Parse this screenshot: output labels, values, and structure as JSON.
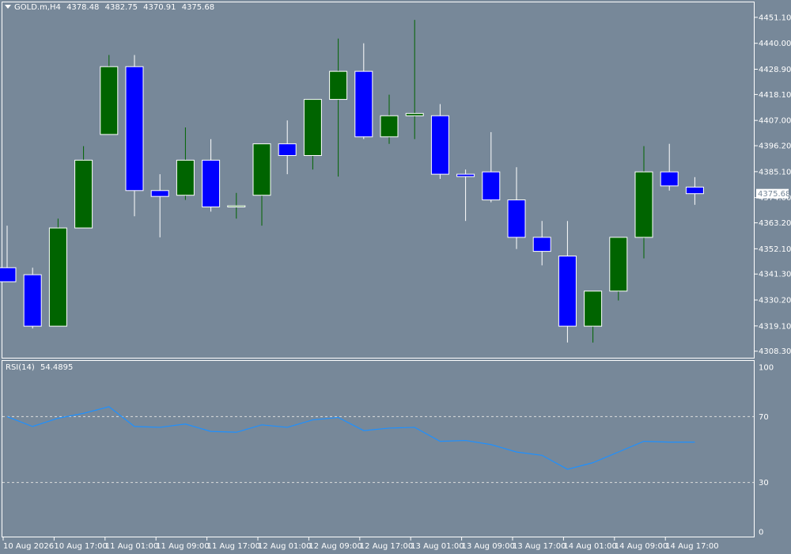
{
  "header": {
    "symbol": "GOLD.m,H4",
    "open": "4378.48",
    "high": "4382.75",
    "low": "4370.91",
    "close": "4375.68"
  },
  "rsi_header": {
    "name": "RSI(14)",
    "value": "54.4895"
  },
  "colors": {
    "background": "#778899",
    "bull_fill": "#006400",
    "bear_fill": "#0000ff",
    "bull_wick": "#006400",
    "bear_wick": "#ffffff",
    "grid_frame": "#ffffff",
    "rsi_line": "#1e90ff",
    "price_tag_bg": "#ffffff",
    "price_tag_text": "#778899"
  },
  "chart_data": [
    {
      "type": "candlestick",
      "title": "GOLD.m,H4",
      "ylim": [
        4305.5,
        4457.5
      ],
      "y_ticks": [
        4451.1,
        4440.0,
        4428.9,
        4418.1,
        4407.0,
        4396.2,
        4385.1,
        4374.0,
        4363.2,
        4352.1,
        4341.3,
        4330.2,
        4319.1,
        4308.3
      ],
      "y_tick_labels": [
        "4451.10",
        "4440.00",
        "4428.90",
        "4418.10",
        "4407.00",
        "4396.20",
        "4385.10",
        "4374.00",
        "4363.20",
        "4352.10",
        "4341.30",
        "4330.20",
        "4319.10",
        "4308.30"
      ],
      "current_price_label": "4375.68",
      "current_price": 4375.68,
      "x_labels": [
        "10 Aug 2026",
        "10 Aug 17:00",
        "11 Aug 01:00",
        "11 Aug 09:00",
        "11 Aug 17:00",
        "12 Aug 01:00",
        "12 Aug 09:00",
        "12 Aug 17:00",
        "13 Aug 01:00",
        "13 Aug 09:00",
        "13 Aug 17:00",
        "14 Aug 01:00",
        "14 Aug 09:00",
        "14 Aug 17:00"
      ],
      "candles": [
        {
          "o": 4344.0,
          "h": 4362.0,
          "l": 4344.0,
          "c": 4338.0
        },
        {
          "o": 4341.0,
          "h": 4344.0,
          "l": 4318.0,
          "c": 4319.0
        },
        {
          "o": 4319.0,
          "h": 4365.0,
          "l": 4319.0,
          "c": 4361.0
        },
        {
          "o": 4361.0,
          "h": 4396.0,
          "l": 4361.0,
          "c": 4390.0
        },
        {
          "o": 4401.0,
          "h": 4435.0,
          "l": 4401.0,
          "c": 4430.0
        },
        {
          "o": 4430.0,
          "h": 4435.0,
          "l": 4366.0,
          "c": 4377.0
        },
        {
          "o": 4377.0,
          "h": 4384.0,
          "l": 4357.0,
          "c": 4374.5
        },
        {
          "o": 4375.0,
          "h": 4404.0,
          "l": 4373.0,
          "c": 4390.0
        },
        {
          "o": 4390.0,
          "h": 4399.0,
          "l": 4368.0,
          "c": 4370.0
        },
        {
          "o": 4370.0,
          "h": 4376.0,
          "l": 4365.0,
          "c": 4370.5
        },
        {
          "o": 4375.0,
          "h": 4397.0,
          "l": 4362.0,
          "c": 4397.0
        },
        {
          "o": 4397.0,
          "h": 4407.0,
          "l": 4384.0,
          "c": 4392.0
        },
        {
          "o": 4392.0,
          "h": 4416.0,
          "l": 4386.0,
          "c": 4416.0
        },
        {
          "o": 4416.0,
          "h": 4442.0,
          "l": 4383.0,
          "c": 4428.0
        },
        {
          "o": 4428.0,
          "h": 4440.0,
          "l": 4399.0,
          "c": 4400.0
        },
        {
          "o": 4400.0,
          "h": 4418.0,
          "l": 4397.0,
          "c": 4409.0
        },
        {
          "o": 4409.0,
          "h": 4450.0,
          "l": 4399.0,
          "c": 4410.0
        },
        {
          "o": 4409.0,
          "h": 4414.0,
          "l": 4382.0,
          "c": 4384.0
        },
        {
          "o": 4384.0,
          "h": 4386.0,
          "l": 4364.0,
          "c": 4383.0
        },
        {
          "o": 4385.0,
          "h": 4402.0,
          "l": 4372.0,
          "c": 4373.0
        },
        {
          "o": 4373.0,
          "h": 4387.0,
          "l": 4352.0,
          "c": 4357.0
        },
        {
          "o": 4357.0,
          "h": 4364.0,
          "l": 4345.0,
          "c": 4351.0
        },
        {
          "o": 4349.0,
          "h": 4364.0,
          "l": 4312.0,
          "c": 4319.0
        },
        {
          "o": 4319.0,
          "h": 4334.0,
          "l": 4312.0,
          "c": 4334.0
        },
        {
          "o": 4334.0,
          "h": 4357.0,
          "l": 4330.0,
          "c": 4357.0
        },
        {
          "o": 4357.0,
          "h": 4396.0,
          "l": 4348.0,
          "c": 4385.0
        },
        {
          "o": 4385.0,
          "h": 4397.0,
          "l": 4377.0,
          "c": 4379.0
        },
        {
          "o": 4378.48,
          "h": 4382.75,
          "l": 4370.91,
          "c": 4375.68
        }
      ]
    },
    {
      "type": "line",
      "title": "RSI(14)",
      "ylim": [
        0,
        100
      ],
      "y_ticks": [
        100,
        70,
        30,
        0
      ],
      "y_tick_labels": [
        "100",
        "70",
        "30",
        "0"
      ],
      "levels": [
        70,
        30
      ],
      "series": [
        {
          "name": "RSI(14)",
          "values": [
            70.0,
            64.0,
            69.0,
            72.0,
            76.0,
            64.0,
            63.5,
            65.5,
            61.0,
            60.5,
            65.0,
            63.5,
            68.0,
            69.5,
            61.5,
            63.0,
            63.5,
            55.0,
            55.5,
            53.0,
            48.5,
            46.5,
            38.0,
            42.0,
            48.5,
            55.0,
            54.5,
            54.49
          ]
        }
      ]
    }
  ]
}
